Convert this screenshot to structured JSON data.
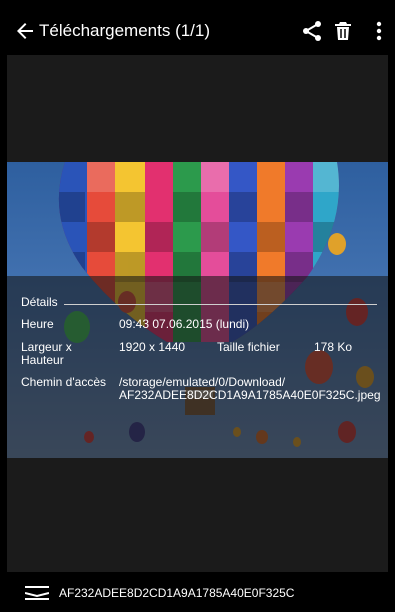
{
  "header": {
    "title": "Téléchargements (1/1)",
    "icons": [
      "back-arrow-icon",
      "share-icon",
      "trash-icon",
      "more-vert-icon"
    ]
  },
  "details": {
    "section_title": "Détails",
    "time_label": "Heure",
    "time_value": "09:43 07.06.2015 (lundi)",
    "dimensions_label_line1": "Largeur x",
    "dimensions_label_line2": "Hauteur",
    "dimensions_value": "1920 x 1440",
    "size_label": "Taille fichier",
    "size_value": "178 Ko",
    "path_label": "Chemin d'accès",
    "path_value_line1": "/storage/emulated/0/Download/",
    "path_value_line2": "AF232ADEE8D2CD1A9A1785A40E0F325C.jpeg"
  },
  "footer": {
    "file_name": "AF232ADEE8D2CD1A9A1785A40E0F325C",
    "icon": "menu-lines-icon"
  },
  "colors": {
    "background": "#000000",
    "viewer_bg": "#1b1b1b",
    "sky": "#3f6fae"
  }
}
